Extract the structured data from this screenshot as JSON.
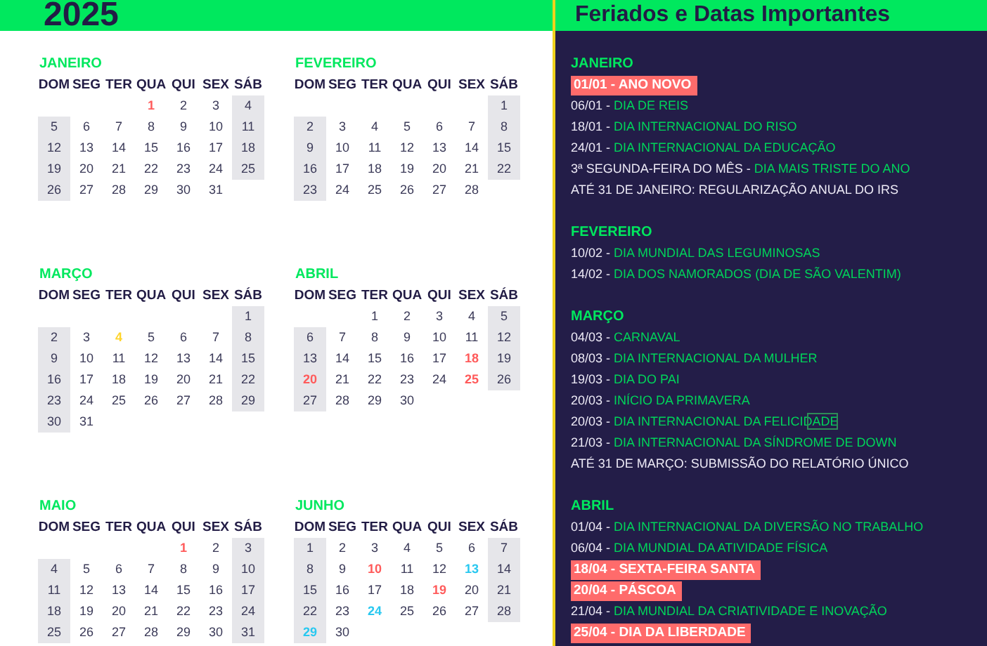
{
  "calendar": {
    "year": "2025",
    "months": [
      {
        "name": "JANEIRO",
        "weekdays": [
          "DOM",
          "SEG",
          "TER",
          "QUA",
          "QUI",
          "SEX",
          "SÁB"
        ],
        "weeks": [
          [
            {
              "day": "1",
              "color": "#ff5b5b"
            },
            "2",
            "3",
            "4"
          ],
          [
            "5",
            "6",
            "7",
            "8",
            "9",
            "10",
            "11"
          ],
          [
            "12",
            "13",
            "14",
            "15",
            "16",
            "17",
            "18"
          ],
          [
            "19",
            "20",
            "21",
            "22",
            "23",
            "24",
            "25"
          ],
          [
            "26",
            "27",
            "28",
            "29",
            "30",
            "31"
          ]
        ]
      },
      {
        "name": "FEVEREIRO",
        "weekdays": [
          "DOM",
          "SEG",
          "TER",
          "QUA",
          "QUI",
          "SEX",
          "SÁB"
        ],
        "weeks": [
          [
            "1"
          ],
          [
            "2",
            "3",
            "4",
            "5",
            "6",
            "7",
            "8"
          ],
          [
            "9",
            "10",
            "11",
            "12",
            "13",
            "14",
            "15"
          ],
          [
            "16",
            "17",
            "18",
            "19",
            "20",
            "21",
            "22"
          ],
          [
            "23",
            "24",
            "25",
            "26",
            "27",
            "28"
          ]
        ]
      },
      {
        "name": "MARÇO",
        "weekdays": [
          "DOM",
          "SEG",
          "TER",
          "QUA",
          "QUI",
          "SEX",
          "SÁB"
        ],
        "weeks": [
          [
            "1"
          ],
          [
            "2",
            "3",
            {
              "day": "4",
              "color": "#ffd42a"
            },
            "5",
            "6",
            "7",
            "8"
          ],
          [
            "9",
            "10",
            "11",
            "12",
            "13",
            "14",
            "15"
          ],
          [
            "16",
            "17",
            "18",
            "19",
            "20",
            "21",
            "22"
          ],
          [
            "23",
            "24",
            "25",
            "26",
            "27",
            "28",
            "29"
          ],
          [
            "30",
            "31"
          ]
        ]
      },
      {
        "name": "ABRIL",
        "weekdays": [
          "DOM",
          "SEG",
          "TER",
          "QUA",
          "QUI",
          "SEX",
          "SÁB"
        ],
        "weeks": [
          [
            "1",
            "2",
            "3",
            "4",
            "5"
          ],
          [
            "6",
            "7",
            "8",
            "9",
            "10",
            "11",
            "12"
          ],
          [
            "13",
            "14",
            "15",
            "16",
            "17",
            {
              "day": "18",
              "color": "#ff5b5b"
            },
            "19"
          ],
          [
            {
              "day": "20",
              "color": "#ff5b5b"
            },
            "21",
            "22",
            "23",
            "24",
            {
              "day": "25",
              "color": "#ff5b5b"
            },
            "26"
          ],
          [
            "27",
            "28",
            "29",
            "30"
          ]
        ]
      },
      {
        "name": "MAIO",
        "weekdays": [
          "DOM",
          "SEG",
          "TER",
          "QUA",
          "QUI",
          "SEX",
          "SÁB"
        ],
        "weeks": [
          [
            {
              "day": "1",
              "color": "#ff5b5b"
            },
            "2",
            "3"
          ],
          [
            "4",
            "5",
            "6",
            "7",
            "8",
            "9",
            "10"
          ],
          [
            "11",
            "12",
            "13",
            "14",
            "15",
            "16",
            "17"
          ],
          [
            "18",
            "19",
            "20",
            "21",
            "22",
            "23",
            "24"
          ],
          [
            "25",
            "26",
            "27",
            "28",
            "29",
            "30",
            "31"
          ]
        ]
      },
      {
        "name": "JUNHO",
        "weekdays": [
          "DOM",
          "SEG",
          "TER",
          "QUA",
          "QUI",
          "SEX",
          "SÁB"
        ],
        "weeks": [
          [
            "1",
            "2",
            "3",
            "4",
            "5",
            "6",
            "7"
          ],
          [
            "8",
            "9",
            {
              "day": "10",
              "color": "#ff5b5b"
            },
            "11",
            "12",
            {
              "day": "13",
              "color": "#29c8f0"
            },
            "14"
          ],
          [
            "15",
            "16",
            "17",
            "18",
            {
              "day": "19",
              "color": "#ff5b5b"
            },
            "20",
            "21"
          ],
          [
            "22",
            "23",
            {
              "day": "24",
              "color": "#29c8f0"
            },
            "25",
            "26",
            "27",
            "28"
          ],
          [
            {
              "day": "29",
              "color": "#29c8f0"
            },
            "30"
          ]
        ]
      }
    ]
  },
  "holidays_panel": {
    "title": "Feriados e Datas Importantes",
    "sections": [
      {
        "month": "JANEIRO",
        "entries": [
          {
            "kind": "holiday",
            "text": "01/01 - ANO NOVO",
            "selected": false
          },
          {
            "kind": "event",
            "date": "06/01 -",
            "name": "DIA DE REIS",
            "selected": false
          },
          {
            "kind": "event",
            "date": "18/01 -",
            "name": "DIA INTERNACIONAL DO RISO",
            "selected": false
          },
          {
            "kind": "event",
            "date": "24/01 -",
            "name": "DIA INTERNACIONAL DA EDUCAÇÃO",
            "selected": false
          },
          {
            "kind": "event",
            "date": "3ª SEGUNDA-FEIRA DO MÊS -",
            "name": "DIA MAIS TRISTE DO ANO",
            "selected": false
          },
          {
            "kind": "note",
            "text": "ATÉ 31 DE JANEIRO: REGULARIZAÇÃO ANUAL DO IRS",
            "selected": false
          }
        ]
      },
      {
        "month": "FEVEREIRO",
        "entries": [
          {
            "kind": "event",
            "date": "10/02 -",
            "name": "DIA MUNDIAL DAS LEGUMINOSAS",
            "selected": false
          },
          {
            "kind": "event",
            "date": "14/02 -",
            "name": "DIA DOS NAMORADOS (DIA DE SÃO VALENTIM)",
            "selected": false
          }
        ]
      },
      {
        "month": "MARÇO",
        "entries": [
          {
            "kind": "event",
            "date": "04/03 -",
            "name": "CARNAVAL",
            "selected": false
          },
          {
            "kind": "event",
            "date": "08/03 -",
            "name": "DIA INTERNACIONAL DA MULHER",
            "selected": false
          },
          {
            "kind": "event",
            "date": "19/03 -",
            "name": "DIA DO PAI",
            "selected": false
          },
          {
            "kind": "event",
            "date": "20/03 -",
            "name": "INÍCIO DA PRIMAVERA",
            "selected": false
          },
          {
            "kind": "event",
            "date": "20/03 -",
            "name": "DIA INTERNACIONAL DA FELICIDADE",
            "selected": true
          },
          {
            "kind": "event",
            "date": "21/03 -",
            "name": "DIA INTERNACIONAL DA SÍNDROME DE DOWN",
            "selected": false
          },
          {
            "kind": "note",
            "text": "ATÉ 31 DE MARÇO: SUBMISSÃO DO RELATÓRIO ÚNICO",
            "selected": false
          }
        ]
      },
      {
        "month": "ABRIL",
        "entries": [
          {
            "kind": "event",
            "date": "01/04 -",
            "name": "DIA INTERNACIONAL DA DIVERSÃO NO TRABALHO",
            "selected": false
          },
          {
            "kind": "event",
            "date": "06/04 -",
            "name": "DIA MUNDIAL DA ATIVIDADE FÍSICA",
            "selected": false
          },
          {
            "kind": "holiday",
            "text": "18/04 - SEXTA-FEIRA SANTA",
            "selected": false
          },
          {
            "kind": "holiday",
            "text": "20/04 - PÁSCOA",
            "selected": false
          },
          {
            "kind": "event",
            "date": "21/04 -",
            "name": "DIA MUNDIAL DA CRIATIVIDADE E INOVAÇÃO",
            "selected": false
          },
          {
            "kind": "holiday",
            "text": "25/04 - DIA DA LIBERDADE",
            "selected": false
          }
        ]
      }
    ]
  }
}
